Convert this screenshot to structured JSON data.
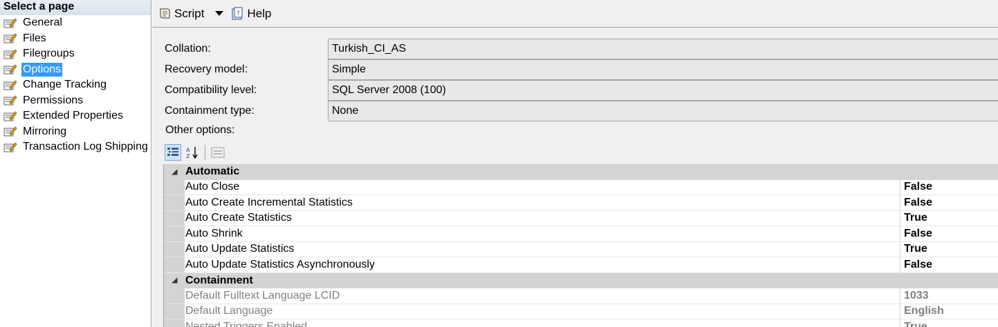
{
  "left_pane": {
    "header": "Select a page",
    "items": [
      {
        "label": "General"
      },
      {
        "label": "Files"
      },
      {
        "label": "Filegroups"
      },
      {
        "label": "Options",
        "selected": true
      },
      {
        "label": "Change Tracking"
      },
      {
        "label": "Permissions"
      },
      {
        "label": "Extended Properties"
      },
      {
        "label": "Mirroring"
      },
      {
        "label": "Transaction Log Shipping"
      }
    ]
  },
  "toolbar": {
    "script_label": "Script",
    "help_label": "Help"
  },
  "fields": {
    "collation": {
      "label": "Collation:",
      "value": "Turkish_CI_AS"
    },
    "recovery_model": {
      "label": "Recovery model:",
      "value": "Simple"
    },
    "compatibility_level": {
      "label": "Compatibility level:",
      "value": "SQL Server 2008 (100)"
    },
    "containment_type": {
      "label": "Containment type:",
      "value": "None"
    }
  },
  "other_options_label": "Other options:",
  "grid": {
    "categories": [
      {
        "name": "Automatic",
        "properties": [
          {
            "name": "Auto Close",
            "value": "False"
          },
          {
            "name": "Auto Create Incremental Statistics",
            "value": "False"
          },
          {
            "name": "Auto Create Statistics",
            "value": "True"
          },
          {
            "name": "Auto Shrink",
            "value": "False"
          },
          {
            "name": "Auto Update Statistics",
            "value": "True"
          },
          {
            "name": "Auto Update Statistics Asynchronously",
            "value": "False"
          }
        ]
      },
      {
        "name": "Containment",
        "properties": [
          {
            "name": "Default Fulltext Language LCID",
            "value": "1033",
            "disabled": true
          },
          {
            "name": "Default Language",
            "value": "English",
            "disabled": true
          },
          {
            "name": "Nested Triggers Enabled",
            "value": "True",
            "disabled": true
          }
        ]
      }
    ]
  },
  "colors": {
    "selection": "#3399ff",
    "category_bg": "#d4d4d4",
    "disabled_text": "#808080"
  }
}
